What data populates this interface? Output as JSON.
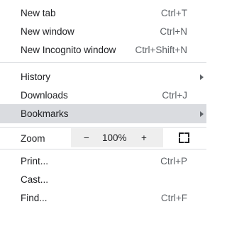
{
  "menu": {
    "group1": [
      {
        "label": "New tab",
        "shortcut": "Ctrl+T"
      },
      {
        "label": "New window",
        "shortcut": "Ctrl+N"
      },
      {
        "label": "New Incognito window",
        "shortcut": "Ctrl+Shift+N"
      }
    ],
    "group2": [
      {
        "label": "History"
      },
      {
        "label": "Downloads",
        "shortcut": "Ctrl+J"
      },
      {
        "label": "Bookmarks"
      }
    ],
    "zoom": {
      "label": "Zoom",
      "minus": "−",
      "value": "100%",
      "plus": "+"
    },
    "group3": [
      {
        "label": "Print...",
        "shortcut": "Ctrl+P"
      },
      {
        "label": "Cast..."
      },
      {
        "label": "Find...",
        "shortcut": "Ctrl+F"
      }
    ]
  },
  "colors": {
    "highlight": "#dadce0",
    "zoom_bg": "#eeeeee",
    "separator": "#dadce0"
  }
}
